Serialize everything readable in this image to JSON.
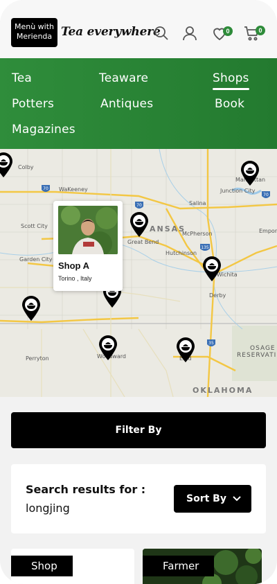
{
  "header": {
    "logo_line1": "Menù with",
    "logo_line2": "Merienda",
    "brand": "Tea everywhere",
    "wishlist_count": "0",
    "cart_count": "0",
    "icons": [
      "search-icon",
      "user-icon",
      "heart-icon",
      "cart-icon"
    ]
  },
  "nav": {
    "items": [
      {
        "label": "Tea"
      },
      {
        "label": "Teaware"
      },
      {
        "label": "Shops",
        "active": true
      },
      {
        "label": "Potters"
      },
      {
        "label": "Antiques"
      },
      {
        "label": "Book"
      },
      {
        "label": "Magazines"
      }
    ]
  },
  "map": {
    "cities": [
      "Colby",
      "WaKeeney",
      "Scott City",
      "Garden City",
      "Perryton",
      "Great Bend",
      "Salina",
      "McPherson",
      "Hutchinson",
      "Junction City",
      "Manhattan",
      "Emporia",
      "Derby",
      "Wichita",
      "Woodward",
      "Enid"
    ],
    "state_labels": [
      "ANSAS",
      "OKLAHOMA",
      "OSAGE",
      "RESERVATI"
    ],
    "highways": [
      "70",
      "70",
      "135",
      "35",
      "70"
    ],
    "popup": {
      "title": "Shop A",
      "location": "Torino , Italy"
    }
  },
  "filter": {
    "label": "Filter By"
  },
  "results": {
    "label": "Search results for :",
    "term": "longjing",
    "sort_label": "Sort By"
  },
  "cards": [
    {
      "label": "Shop"
    },
    {
      "label": "Farmer"
    }
  ],
  "colors": {
    "nav_green": "#2f8d3b",
    "badge_green": "#2e8b3a",
    "black": "#000000"
  }
}
